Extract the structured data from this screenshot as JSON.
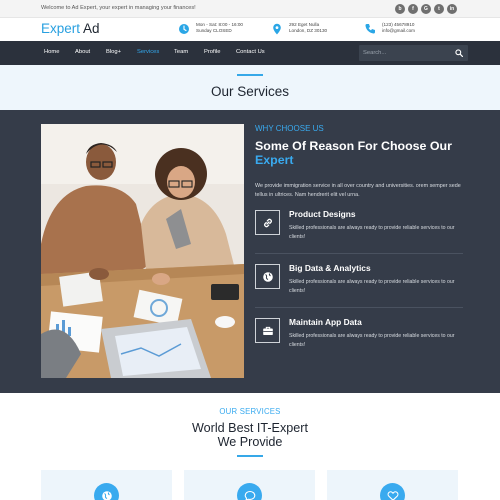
{
  "topbar": {
    "welcome": "Welcome to Ad Expert, your expert in managing your finances!",
    "social_icons": [
      "behance-icon",
      "facebook-icon",
      "google-plus-icon",
      "twitter-icon",
      "linkedin-icon"
    ],
    "social_glyphs": [
      "b",
      "f",
      "G",
      "t",
      "in"
    ]
  },
  "brand": {
    "logo_part1": "Expert",
    "logo_part2": "Ad",
    "logo_colors": [
      "#29a0e0",
      "#1f2731"
    ]
  },
  "contacts": [
    {
      "icon": "clock-icon",
      "line1": "Mon - Sat: 8:00 - 16:00",
      "line2": "Sunday CLOSED"
    },
    {
      "icon": "map-pin-icon",
      "line1": "292 Eget Nulla",
      "line2": "London, DZ 30130"
    },
    {
      "icon": "phone-icon",
      "line1": "(123) 45678910",
      "line2": "info@gmail.com"
    }
  ],
  "nav": {
    "items": [
      {
        "label": "Home"
      },
      {
        "label": "About"
      },
      {
        "label": "Blog+"
      },
      {
        "label": "Services",
        "active": true
      },
      {
        "label": "Team"
      },
      {
        "label": "Profile"
      },
      {
        "label": "Contact Us"
      }
    ],
    "search_placeholder": "Search..."
  },
  "page_title": "Our Services",
  "why": {
    "eyebrow": "WHY CHOOSE US",
    "title_main": "Some Of Reason For Choose Our",
    "title_highlight": "Expert",
    "description": "We provide immigration service in all over country and universities. orem semper sede tellus in ultrices. Nam hendrerit elit vel urna.",
    "features": [
      {
        "icon": "link-icon",
        "title": "Product Designs",
        "desc": "Skilled professionals are always ready to provide reliable services to our clients!"
      },
      {
        "icon": "globe-icon",
        "title": "Big Data & Analytics",
        "desc": "Skilled professionals are always ready to provide reliable services to our clients!"
      },
      {
        "icon": "briefcase-icon",
        "title": "Maintain App Data",
        "desc": "Skilled professionals are always ready to provide reliable services to our clients!"
      }
    ]
  },
  "services": {
    "eyebrow": "OUR SERVICES",
    "title_line1": "World Best IT-Expert",
    "title_line2": "We Provide",
    "cards": [
      {
        "icon": "globe-icon"
      },
      {
        "icon": "chat-icon"
      },
      {
        "icon": "heart-icon"
      }
    ]
  },
  "colors": {
    "accent": "#36a8e8",
    "nav_bg": "#2b313c",
    "section_dark": "#353c49",
    "title_band": "#eef6fc"
  }
}
